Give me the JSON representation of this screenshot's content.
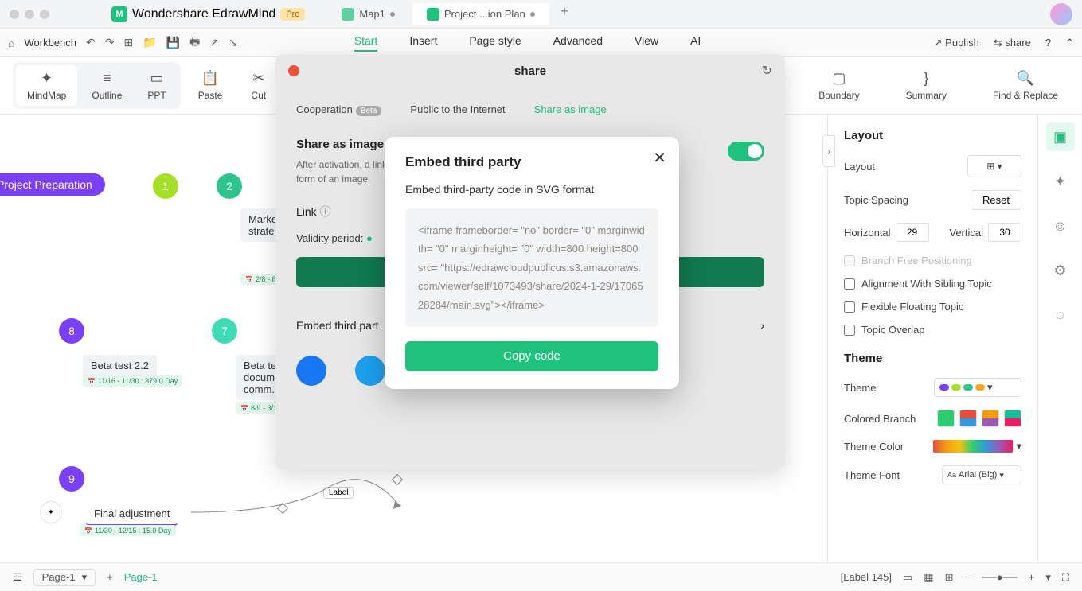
{
  "titlebar": {
    "app_name": "Wondershare EdrawMind",
    "pro": "Pro",
    "tabs": [
      {
        "label": "Map1"
      },
      {
        "label": "Project ...ion Plan"
      }
    ]
  },
  "menubar": {
    "workbench": "Workbench",
    "items": [
      "Start",
      "Insert",
      "Page style",
      "Advanced",
      "View",
      "AI"
    ],
    "publish": "Publish",
    "share": "share"
  },
  "toolbar": {
    "mindmap": "MindMap",
    "outline": "Outline",
    "ppt": "PPT",
    "paste": "Paste",
    "cut": "Cut",
    "boundary": "Boundary",
    "summary": "Summary",
    "find": "Find & Replace"
  },
  "canvas": {
    "project_prep": "Project Preparation",
    "n1": "1",
    "n2": "2",
    "n7": "7",
    "n8": "8",
    "n9": "9",
    "market": "Market analysis and Strategy strategy",
    "beta22": "Beta test 2.2",
    "betadoc": "Beta test document, comm...",
    "final": "Final adjustment",
    "d1": "2/8 - 8/9",
    "d2": "11/16 - 11/30 : 379.0 Day",
    "d3": "8/9 - 3/10 : ...",
    "d4": "11/30 - 12/15 : 15.0 Day",
    "label": "Label"
  },
  "share_modal": {
    "title": "share",
    "tab_coop": "Cooperation",
    "beta": "Beta",
    "tab_public": "Public to the Internet",
    "tab_image": "Share as image",
    "section_title": "Share as image",
    "desc": "After activation, a link will be generated, and other users can view the file in the form of an image.",
    "link": "Link",
    "validity": "Validity period:",
    "embed_row": "Embed third part"
  },
  "embed_modal": {
    "title": "Embed third party",
    "subtitle": "Embed third-party code in SVG format",
    "code": "<iframe frameborder= \"no\" border= \"0\" marginwidth= \"0\" marginheight= \"0\" width=800 height=800 src= \"https://edrawcloudpublicus.s3.amazonaws.com/viewer/self/1073493/share/2024-1-29/1706528284/main.svg\"></iframe>",
    "copy": "Copy code"
  },
  "right_panel": {
    "layout_title": "Layout",
    "layout_label": "Layout",
    "topic_spacing": "Topic Spacing",
    "reset": "Reset",
    "horizontal": "Horizontal",
    "h_val": "29",
    "vertical": "Vertical",
    "v_val": "30",
    "branch_free": "Branch Free Positioning",
    "align_sibling": "Alignment With Sibling Topic",
    "flexible": "Flexible Floating Topic",
    "overlap": "Topic Overlap",
    "theme_title": "Theme",
    "theme_label": "Theme",
    "colored_branch": "Colored Branch",
    "theme_color": "Theme Color",
    "theme_font": "Theme Font",
    "font_val": "Arial (Big)"
  },
  "statusbar": {
    "page_sel": "Page-1",
    "page_tab": "Page-1",
    "label_count": "[Label 145]"
  }
}
